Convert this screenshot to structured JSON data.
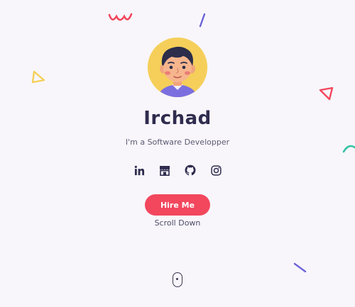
{
  "profile": {
    "name": "Irchad",
    "subtitle": "I'm a Software Developper"
  },
  "socials": [
    {
      "icon": "linkedin-icon"
    },
    {
      "icon": "store-icon"
    },
    {
      "icon": "github-icon"
    },
    {
      "icon": "instagram-icon"
    }
  ],
  "cta": {
    "label": "Hire Me"
  },
  "scroll": {
    "label": "Scroll Down"
  },
  "colors": {
    "background": "#f8f6fb",
    "accent": "#f2475d",
    "heading": "#2f2c4e",
    "avatar_bg": "#f5cf5a",
    "deco_red": "#f2475d",
    "deco_purple": "#6c63d8",
    "deco_yellow": "#f5cf5a",
    "deco_teal": "#35c2a4"
  }
}
